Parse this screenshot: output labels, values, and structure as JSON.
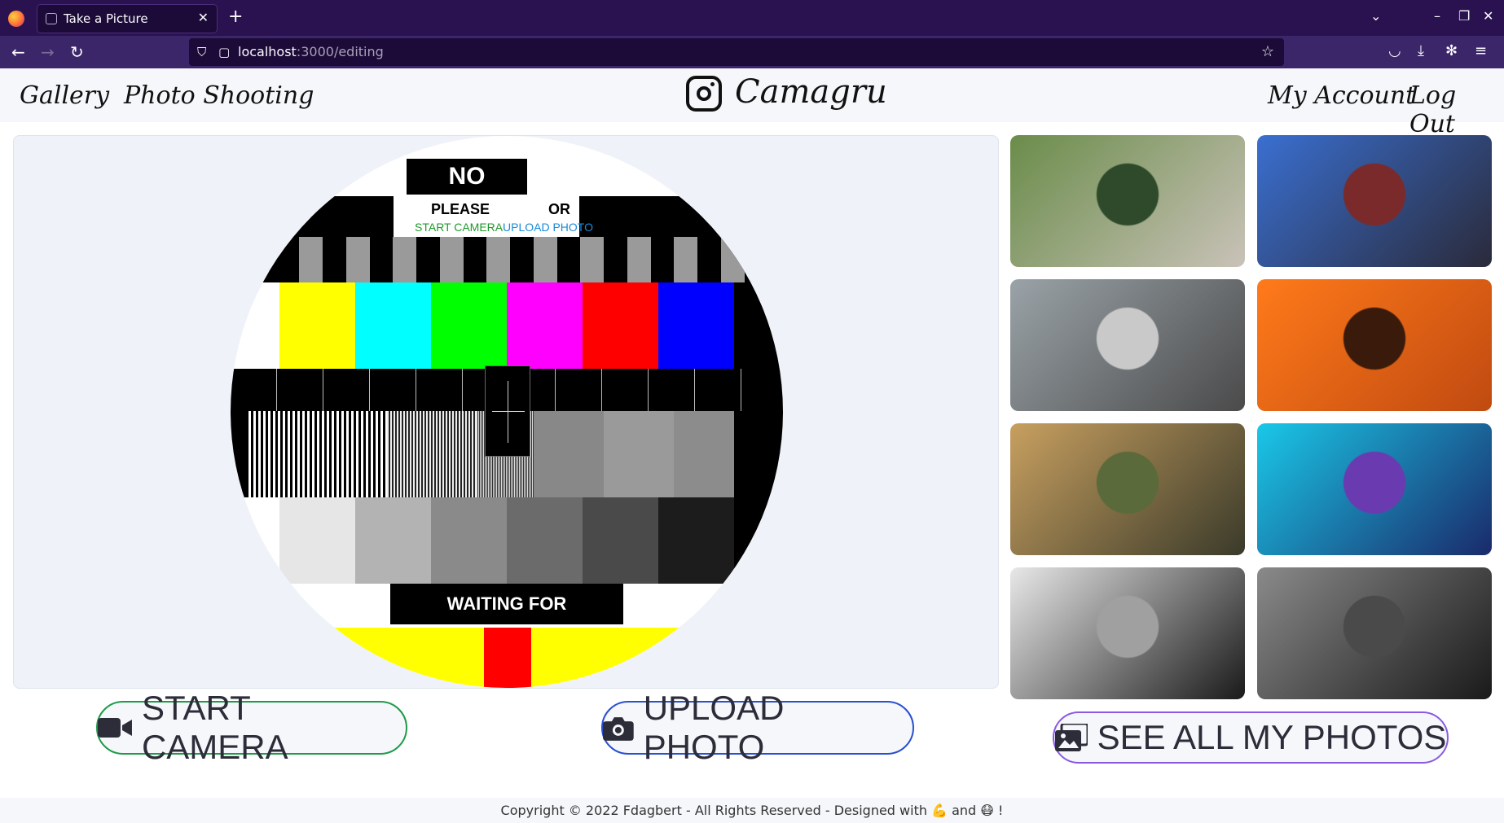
{
  "browser": {
    "tab_title": "Take a Picture",
    "url_host": "localhost",
    "url_path": ":3000/editing"
  },
  "nav": {
    "gallery": "Gallery",
    "photo_shooting": "Photo Shooting",
    "brand": "Camagru",
    "my_account": "My Account",
    "log_out": "Log Out"
  },
  "testcard": {
    "title": "NO SIGNAL",
    "please": "PLEASE",
    "or": "OR",
    "start_camera": "START CAMERA",
    "upload_photo": "UPLOAD PHOTO",
    "waiting": "WAITING FOR TRANSMISSION",
    "color_bars": [
      "#ffff00",
      "#00ffff",
      "#00ff00",
      "#ff00ff",
      "#ff0000",
      "#0000ff"
    ],
    "gray_bars": [
      "#e6e6e6",
      "#b3b3b3",
      "#8a8a8a",
      "#6b6b6b",
      "#4a4a4a",
      "#1c1c1c"
    ]
  },
  "buttons": {
    "start_camera": "START CAMERA",
    "upload_photo": "UPLOAD PHOTO",
    "see_all": "SEE ALL MY PHOTOS"
  },
  "gallery": [
    {
      "alt": "family-masks-photo",
      "colors": [
        "#6a8c4a",
        "#2e4a2a",
        "#c9c2b8"
      ]
    },
    {
      "alt": "bluntman-gas-mask-photo",
      "colors": [
        "#3a6fd0",
        "#7a2a2a",
        "#2a2a3a"
      ]
    },
    {
      "alt": "gta-car-photo",
      "colors": [
        "#9aa3a8",
        "#c9c9c9",
        "#4a4a4a"
      ]
    },
    {
      "alt": "fire-thug-photo",
      "colors": [
        "#ff7a1a",
        "#3a1a0a",
        "#c04a10"
      ]
    },
    {
      "alt": "halo-soldier-photo",
      "colors": [
        "#c8a060",
        "#5a6a3a",
        "#3a3a2a"
      ]
    },
    {
      "alt": "anonymous-neon-photo",
      "colors": [
        "#1ac8e8",
        "#6a3ab0",
        "#1a2a6a"
      ]
    },
    {
      "alt": "clown-mask-photo",
      "colors": [
        "#e8e8e8",
        "#a0a0a0",
        "#1a1a1a"
      ]
    },
    {
      "alt": "42-man-photo",
      "colors": [
        "#8a8a8a",
        "#4a4a4a",
        "#1a1a1a"
      ]
    }
  ],
  "footer": {
    "text": "Copyright © 2022 Fdagbert - All Rights Reserved - Designed with 💪 and 😷 !"
  },
  "colors": {
    "start_camera_border": "#1f9a4a",
    "upload_photo_border": "#2a4fd0",
    "see_all_border": "#8a5ae0"
  }
}
